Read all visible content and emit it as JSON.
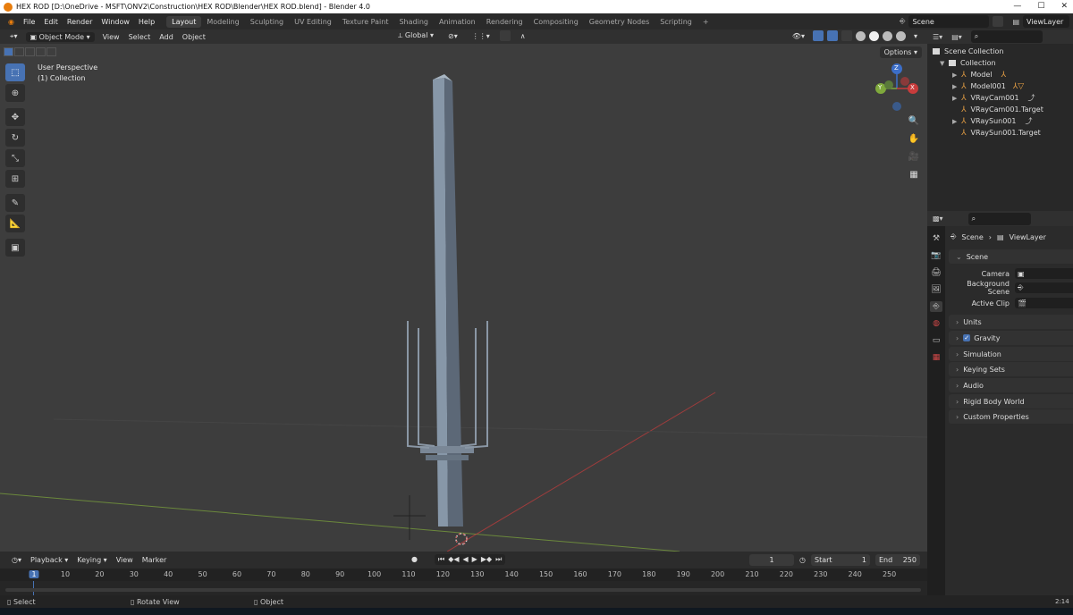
{
  "window": {
    "title": "HEX ROD [D:\\OneDrive - MSFT\\ONV2\\Construction\\HEX ROD\\Blender\\HEX ROD.blend] - Blender 4.0"
  },
  "menu": [
    "File",
    "Edit",
    "Render",
    "Window",
    "Help"
  ],
  "workspaces": [
    "Layout",
    "Modeling",
    "Sculpting",
    "UV Editing",
    "Texture Paint",
    "Shading",
    "Animation",
    "Rendering",
    "Compositing",
    "Geometry Nodes",
    "Scripting"
  ],
  "active_workspace": "Layout",
  "topbar_right": {
    "scene": "Scene",
    "view_layer": "ViewLayer",
    "add_tab": "+"
  },
  "viewport_header": {
    "mode": "Object Mode",
    "menus": [
      "View",
      "Select",
      "Add",
      "Object"
    ],
    "orientation": "Global"
  },
  "viewport": {
    "perspective": "User Perspective",
    "collection": "(1) Collection",
    "options": "Options",
    "gizmo": {
      "z": "Z",
      "y": "Y",
      "x": "X"
    }
  },
  "toolbar_icons": [
    "select-box-icon",
    "cursor-icon",
    "move-icon",
    "rotate-icon",
    "scale-icon",
    "transform-icon",
    "annotate-icon",
    "measure-icon",
    "add-cube-icon"
  ],
  "timeline": {
    "menus": [
      "Playback",
      "Keying",
      "View",
      "Marker"
    ],
    "current_frame": "1",
    "start_label": "Start",
    "start": "1",
    "end_label": "End",
    "end": "250",
    "ticks": [
      "1",
      "10",
      "20",
      "30",
      "40",
      "50",
      "60",
      "70",
      "80",
      "90",
      "100",
      "110",
      "120",
      "130",
      "140",
      "150",
      "160",
      "170",
      "180",
      "190",
      "200",
      "210",
      "220",
      "230",
      "240",
      "250"
    ]
  },
  "statusbar": {
    "select": "Select",
    "rotate": "Rotate View",
    "object": "Object",
    "clock": "2:14"
  },
  "outliner": {
    "scene_collection": "Scene Collection",
    "collection": "Collection",
    "items": [
      "Model",
      "Model001",
      "VRayCam001",
      "VRayCam001.Target",
      "VRaySun001",
      "VRaySun001.Target"
    ]
  },
  "properties": {
    "breadcrumb_scene": "Scene",
    "breadcrumb_layer": "ViewLayer",
    "panel_scene": "Scene",
    "camera_label": "Camera",
    "background_label": "Background Scene",
    "clip_label": "Active Clip",
    "panels": [
      "Units",
      "Gravity",
      "Simulation",
      "Keying Sets",
      "Audio",
      "Rigid Body World",
      "Custom Properties"
    ]
  },
  "colors": {
    "accent": "#4772b3",
    "viewport_bg": "#3d3d3d",
    "x_axis": "#c83c3c",
    "y_axis": "#7fa93c",
    "z_axis": "#3c6ec8"
  }
}
